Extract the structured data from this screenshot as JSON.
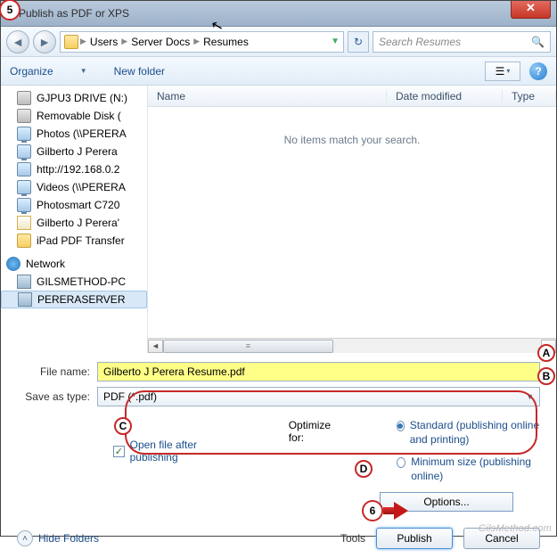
{
  "window": {
    "title": "Publish as PDF or XPS"
  },
  "nav": {
    "path": [
      "Users",
      "Server Docs",
      "Resumes"
    ],
    "search_placeholder": "Search Resumes"
  },
  "toolbar": {
    "organize": "Organize",
    "newfolder": "New folder"
  },
  "sidebar": {
    "items": [
      {
        "label": "GJPU3 DRIVE (N:)",
        "icon": "drive"
      },
      {
        "label": "Removable Disk (",
        "icon": "drive"
      },
      {
        "label": "Photos (\\\\PERERA",
        "icon": "mon"
      },
      {
        "label": "Gilberto J Perera",
        "icon": "mon"
      },
      {
        "label": "http://192.168.0.2",
        "icon": "monx"
      },
      {
        "label": "Videos (\\\\PERERA",
        "icon": "mon"
      },
      {
        "label": "Photosmart C720",
        "icon": "mon"
      },
      {
        "label": "Gilberto J Perera'",
        "icon": "doc"
      },
      {
        "label": "iPad PDF Transfer",
        "icon": "folder"
      }
    ],
    "network_label": "Network",
    "network_items": [
      {
        "label": "GILSMETHOD-PC"
      },
      {
        "label": "PERERASERVER"
      }
    ]
  },
  "columns": {
    "name": "Name",
    "date": "Date modified",
    "type": "Type"
  },
  "list": {
    "empty": "No items match your search."
  },
  "form": {
    "filename_label": "File name:",
    "filename_value": "Gilberto J Perera Resume.pdf",
    "savetype_label": "Save as type:",
    "savetype_value": "PDF (*.pdf)",
    "open_after": "Open file after publishing",
    "optimize_label": "Optimize for:",
    "opt_standard": "Standard (publishing online and printing)",
    "opt_min": "Minimum size (publishing online)",
    "options_btn": "Options..."
  },
  "footer": {
    "hide_folders": "Hide Folders",
    "tools": "Tools",
    "publish": "Publish",
    "cancel": "Cancel"
  },
  "annotations": {
    "5": "5",
    "A": "A",
    "B": "B",
    "C": "C",
    "D": "D",
    "6": "6"
  },
  "watermark": "GilsMethod.com"
}
